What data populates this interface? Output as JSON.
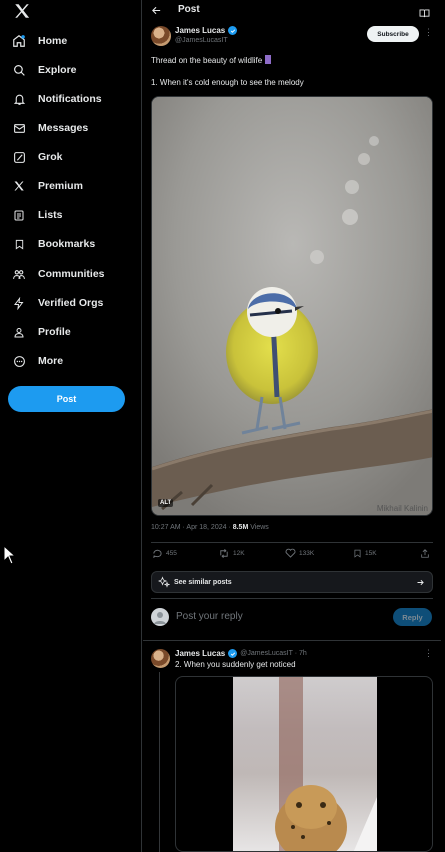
{
  "sidebar": {
    "items": [
      {
        "label": "Home",
        "icon": "home-icon"
      },
      {
        "label": "Explore",
        "icon": "search-icon"
      },
      {
        "label": "Notifications",
        "icon": "bell-icon"
      },
      {
        "label": "Messages",
        "icon": "mail-icon"
      },
      {
        "label": "Grok",
        "icon": "grok-icon"
      },
      {
        "label": "Premium",
        "icon": "x-icon"
      },
      {
        "label": "Lists",
        "icon": "list-icon"
      },
      {
        "label": "Bookmarks",
        "icon": "bookmark-icon"
      },
      {
        "label": "Communities",
        "icon": "people-icon"
      },
      {
        "label": "Verified Orgs",
        "icon": "lightning-icon"
      },
      {
        "label": "Profile",
        "icon": "person-icon"
      },
      {
        "label": "More",
        "icon": "more-circle-icon"
      }
    ],
    "post_label": "Post"
  },
  "header": {
    "title": "Post"
  },
  "tweet": {
    "author": "James Lucas",
    "handle": "@JamesLucasIT",
    "subscribe_label": "Subscribe",
    "text_line1": "Thread on the beauty of wildlife",
    "text_line2": "1. When it's cold enough to see the melody",
    "alt_badge": "ALT",
    "watermark": "Mikhail Kalinin",
    "timestamp": "10:27 AM · Apr 18, 2024 · ",
    "views_count": "8.5M",
    "views_label": " Views",
    "replies": "455",
    "reposts": "12K",
    "likes": "133K",
    "bookmarks": "15K",
    "similar_label": "See similar posts"
  },
  "reply_box": {
    "placeholder": "Post your reply",
    "button": "Reply"
  },
  "reply": {
    "author": "James Lucas",
    "handle_time": "@JamesLucasIT · 7h",
    "text": "2. When you suddenly get noticed"
  },
  "colors": {
    "accent": "#1d9bf0",
    "background": "#000000"
  }
}
